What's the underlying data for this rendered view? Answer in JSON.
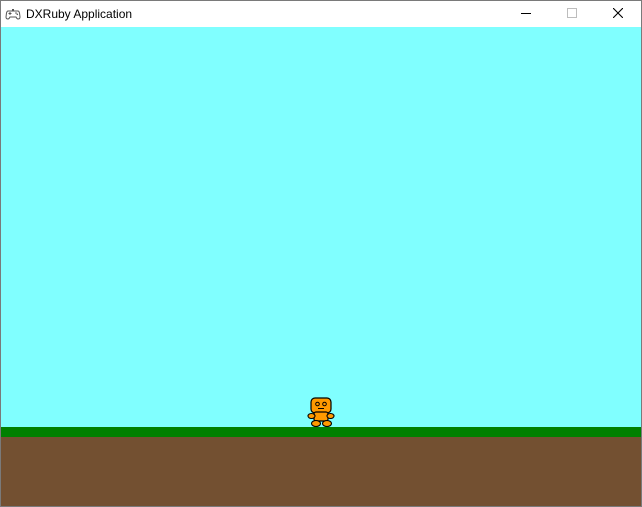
{
  "window": {
    "title": "DXRuby Application",
    "icon": "gamepad-icon",
    "buttons": {
      "minimize_icon": "minimize-icon",
      "maximize_icon": "maximize-icon",
      "close_icon": "close-icon"
    }
  },
  "game": {
    "sky_color": "#80ffff",
    "grass_color": "#008000",
    "ground_color": "#735031",
    "player": {
      "icon": "player-character-icon",
      "body_color": "#ff9900",
      "outline_color": "#000000"
    }
  }
}
